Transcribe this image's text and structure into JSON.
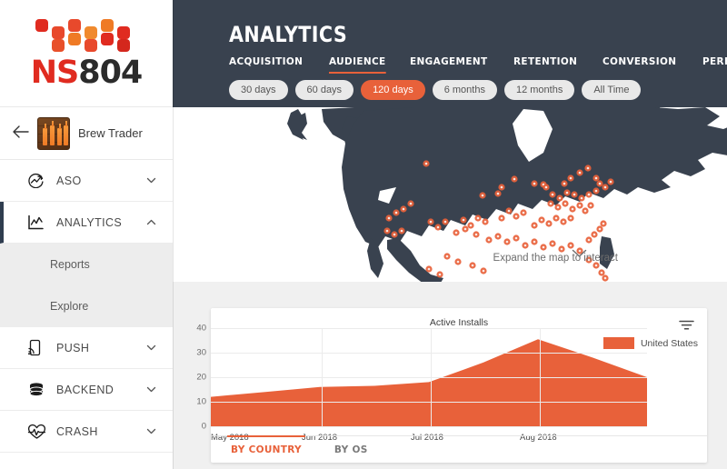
{
  "brand": {
    "logo_text_primary": "NS",
    "logo_text_secondary": "804",
    "accent_color": "#e8613a",
    "header_bg": "#39424f",
    "logo_red": "#e02b20"
  },
  "sidebar": {
    "app": {
      "back_icon": "back-arrow-icon",
      "name": "Brew Trader",
      "icon_name": "brew-trader-app-icon",
      "icon_label": "BREW"
    },
    "items": [
      {
        "label": "ASO",
        "icon": "aso-trend-icon",
        "chevron": "chevron-down-icon",
        "active": false
      },
      {
        "label": "ANALYTICS",
        "icon": "analytics-chart-icon",
        "chevron": "chevron-up-icon",
        "active": true
      },
      {
        "label": "PUSH",
        "icon": "push-notification-icon",
        "chevron": "chevron-down-icon",
        "active": false
      },
      {
        "label": "BACKEND",
        "icon": "database-icon",
        "chevron": "chevron-down-icon",
        "active": false
      },
      {
        "label": "CRASH",
        "icon": "crash-heartbeat-icon",
        "chevron": "chevron-down-icon",
        "active": false
      }
    ],
    "subitems": [
      {
        "label": "Reports"
      },
      {
        "label": "Explore"
      }
    ]
  },
  "header": {
    "title": "ANALYTICS",
    "tabs": [
      {
        "label": "ACQUISITION",
        "active": false
      },
      {
        "label": "AUDIENCE",
        "active": true
      },
      {
        "label": "ENGAGEMENT",
        "active": false
      },
      {
        "label": "RETENTION",
        "active": false
      },
      {
        "label": "CONVERSION",
        "active": false
      },
      {
        "label": "PERFORMANCE",
        "active": false
      }
    ],
    "ranges": [
      {
        "label": "30 days",
        "active": false
      },
      {
        "label": "60 days",
        "active": false
      },
      {
        "label": "120 days",
        "active": true
      },
      {
        "label": "6 months",
        "active": false
      },
      {
        "label": "12 months",
        "active": false
      },
      {
        "label": "All Time",
        "active": false
      }
    ]
  },
  "map": {
    "hint": "Expand the map to interact",
    "chevron": "chevron-down-icon",
    "land_color": "#39424f",
    "point_color": "#e8613a",
    "region": "North America"
  },
  "card": {
    "filter_icon": "filter-icon",
    "tabs": [
      {
        "label": "BY COUNTRY",
        "active": true
      },
      {
        "label": "BY OS",
        "active": false
      }
    ]
  },
  "chart_data": {
    "type": "area",
    "title": "Active Installs",
    "xlabel": "",
    "ylabel": "",
    "ylim": [
      0,
      40
    ],
    "yticks": [
      0,
      10,
      20,
      30,
      40
    ],
    "grid": true,
    "legend_position": "right",
    "series": [
      {
        "name": "United States",
        "color": "#e8613a",
        "x": [
          "May 2018",
          "",
          "Jun 2018",
          "",
          "Jul 2018",
          "",
          "Aug 2018",
          "",
          ""
        ],
        "values": [
          12,
          14,
          16,
          16.5,
          18,
          26,
          35.5,
          28,
          20
        ]
      }
    ],
    "xticks": [
      "May 2018",
      "Jun 2018",
      "Jul 2018",
      "Aug 2018"
    ],
    "legend": [
      "United States"
    ]
  }
}
